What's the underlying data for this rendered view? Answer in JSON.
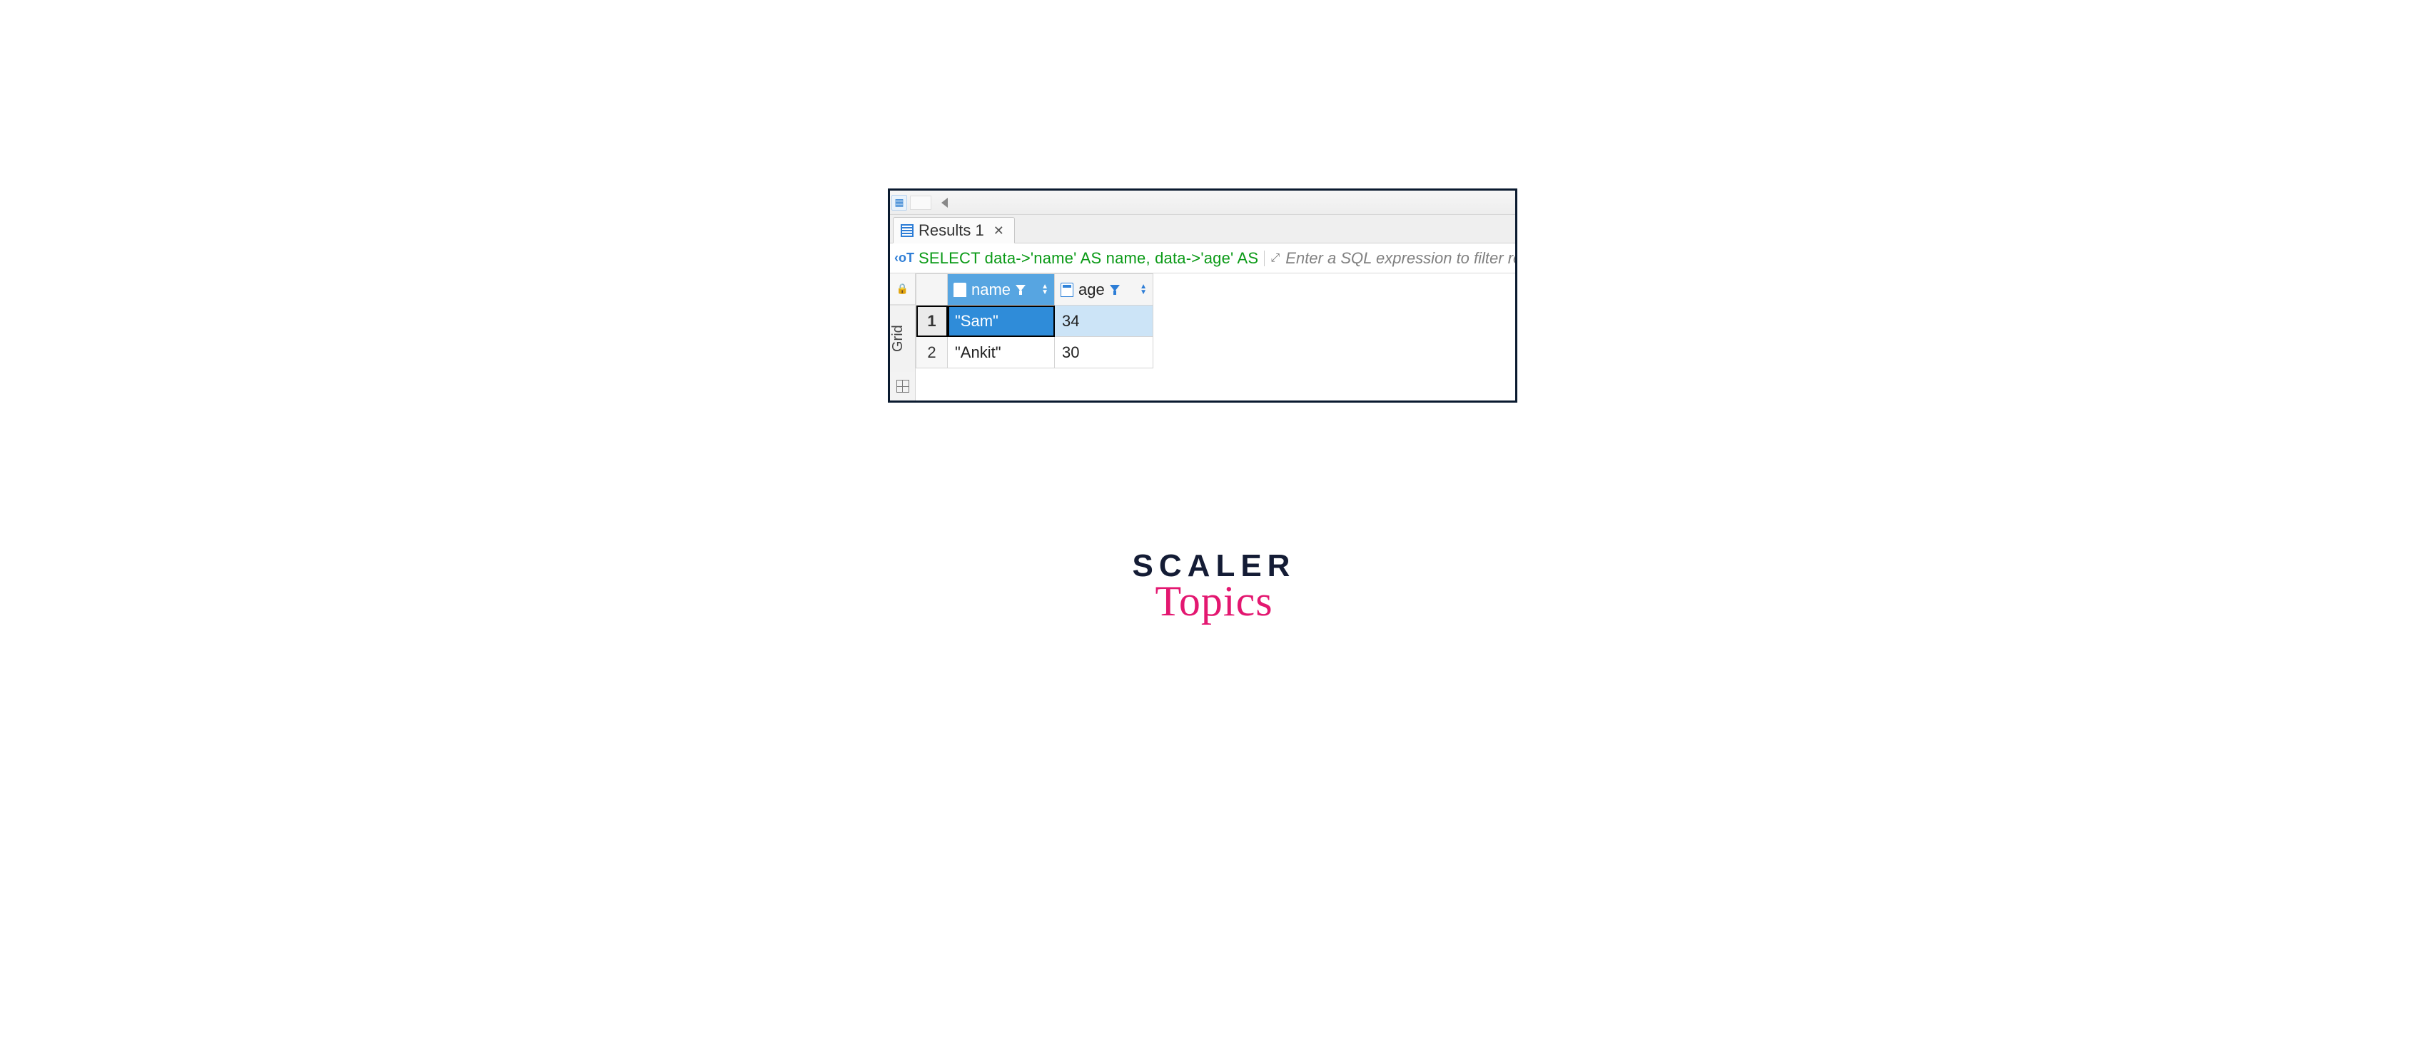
{
  "tab": {
    "label": "Results 1"
  },
  "query": {
    "text": "SELECT data->'name' AS name, data->'age' AS",
    "filter_placeholder": "Enter a SQL expression to filter results (us"
  },
  "grid": {
    "side_label": "Grid",
    "columns": [
      {
        "label": "name"
      },
      {
        "label": "age"
      }
    ],
    "rows": [
      {
        "num": "1",
        "name": "\"Sam\"",
        "age": "34",
        "selected": true
      },
      {
        "num": "2",
        "name": "\"Ankit\"",
        "age": "30",
        "selected": false
      }
    ]
  },
  "logo": {
    "line1": "SCALER",
    "line2": "Topics"
  }
}
